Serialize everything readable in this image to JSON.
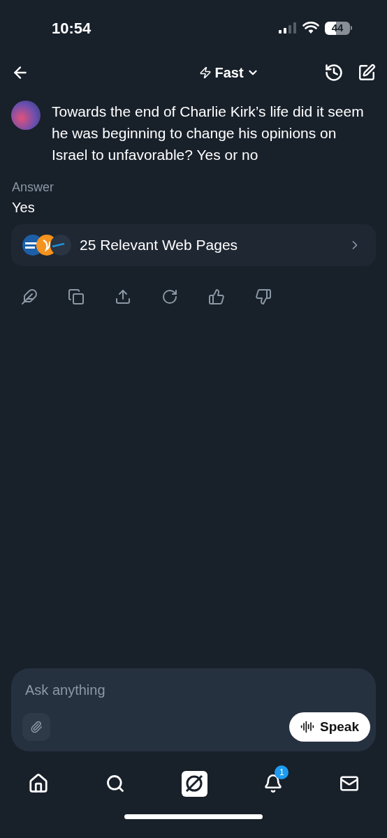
{
  "status_bar": {
    "time": "10:54",
    "battery": "44"
  },
  "header": {
    "mode": "Fast"
  },
  "question": {
    "text": "Towards the end of Charlie Kirk’s life did it seem he was beginning to change his opinions on Israel to unfavorable? Yes or no"
  },
  "answer": {
    "label": "Answer",
    "text": "Yes"
  },
  "sources": {
    "label": "25 Relevant Web Pages"
  },
  "composer": {
    "placeholder": "Ask anything",
    "speak_button": "Speak"
  },
  "tab_bar": {
    "notifications_badge": "1"
  }
}
